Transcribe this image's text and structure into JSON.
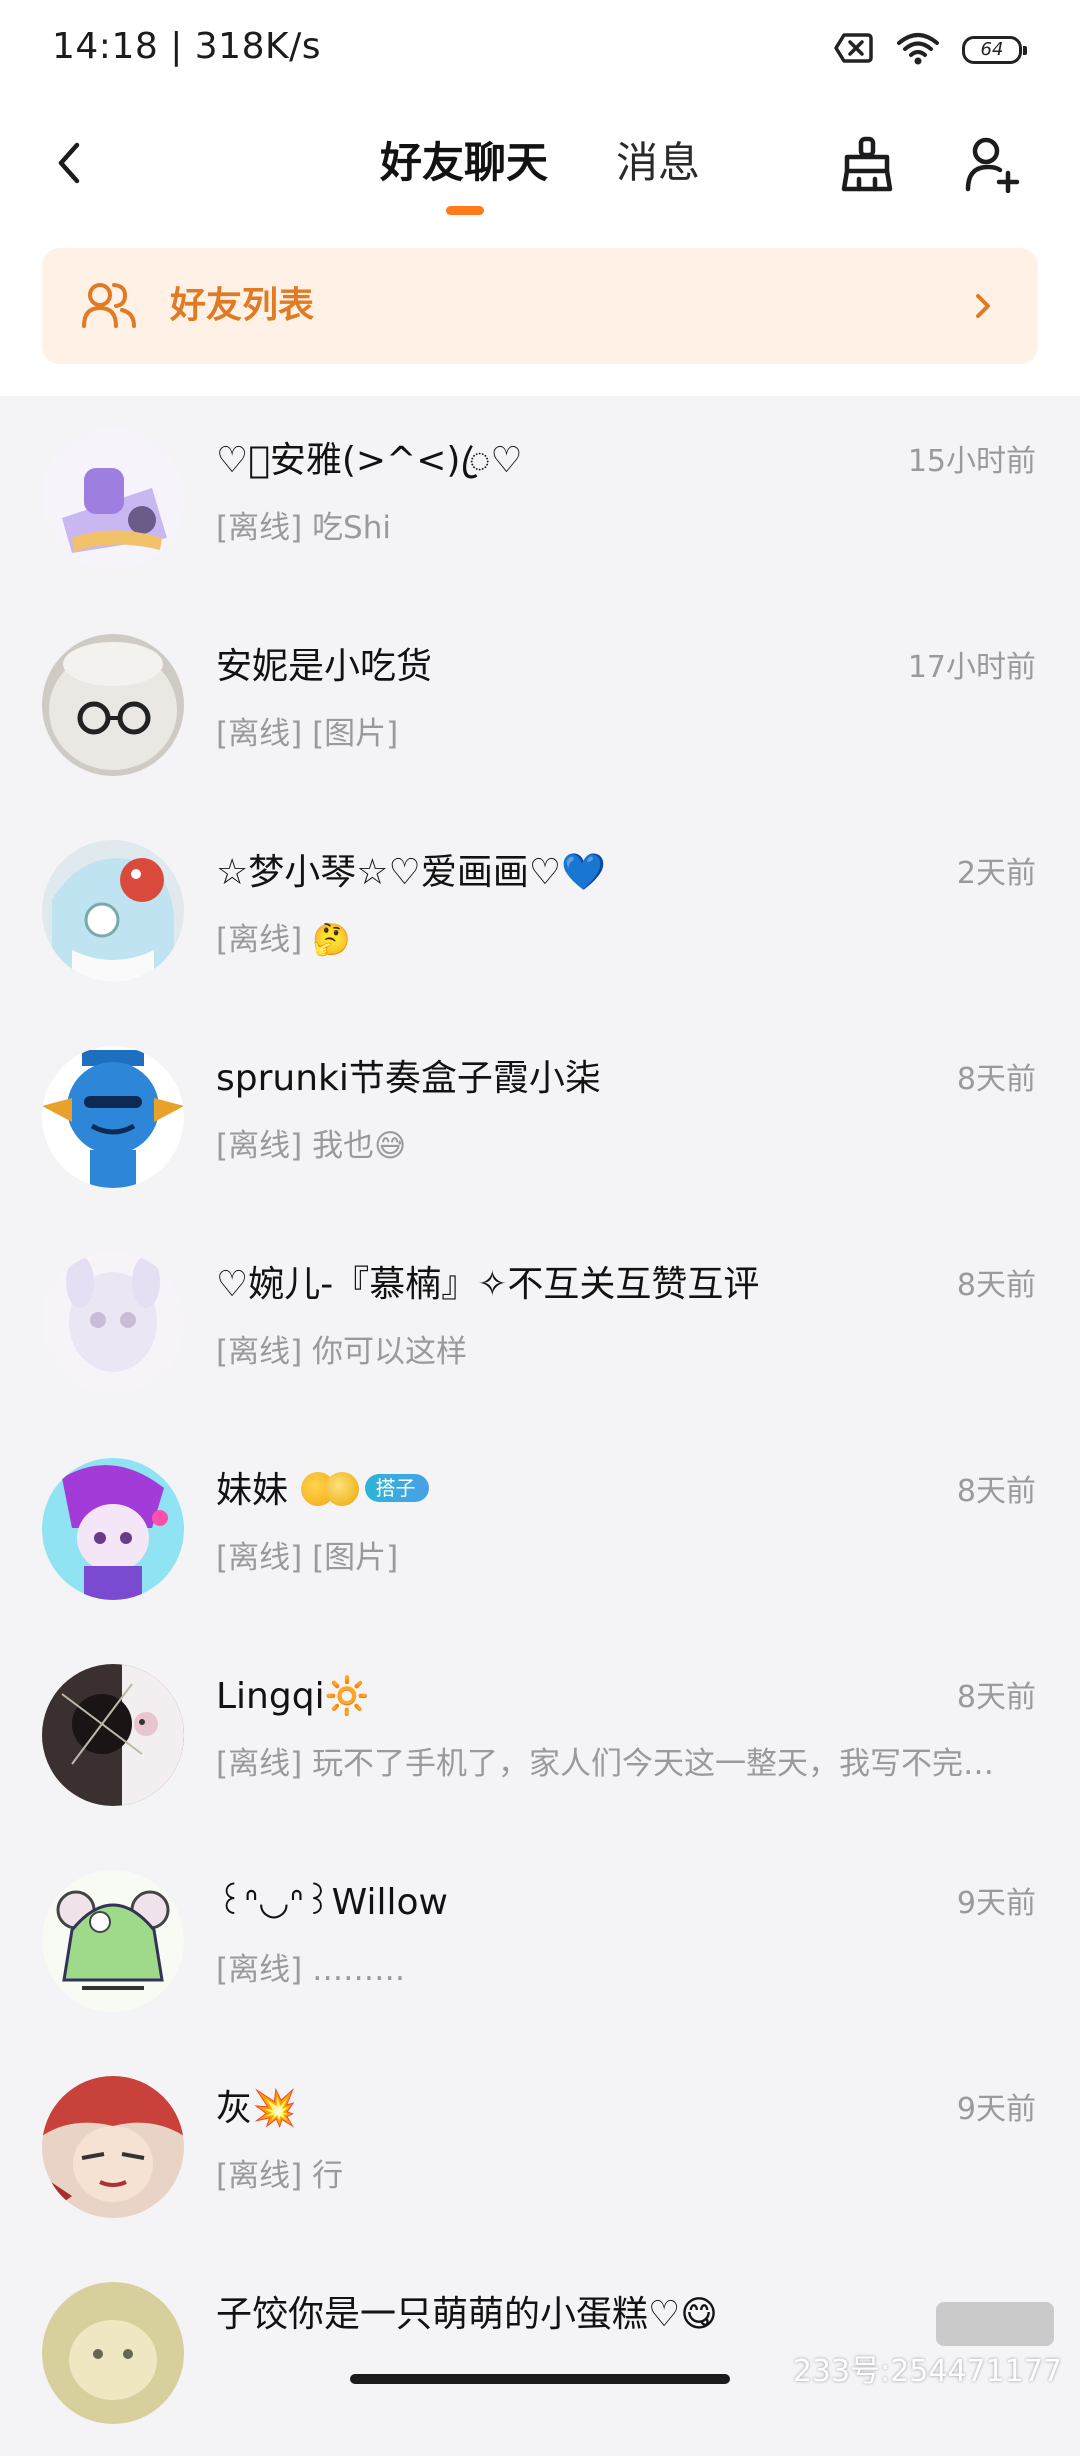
{
  "status_bar": {
    "time_speed": "14:18 | 318K/s",
    "battery": "64"
  },
  "header": {
    "tabs": [
      {
        "label": "好友聊天",
        "active": true
      },
      {
        "label": "消息",
        "active": false
      }
    ],
    "accent_color": "#ff7a1a"
  },
  "friend_list_entry": {
    "label": "好友列表"
  },
  "chats": [
    {
      "name": "♡ꦿ安雅(>^<)ꦿ♡",
      "status": "[离线]",
      "message": "吃Shi",
      "time": "15小时前",
      "avatar_color": "#c9b7f2"
    },
    {
      "name": "安妮是小吃货",
      "status": "[离线]",
      "message": "[图片]",
      "time": "17小时前",
      "avatar_color": "#dedad5"
    },
    {
      "name": "☆梦小琴☆♡爱画画♡💙",
      "status": "[离线]",
      "message": "🤔",
      "time": "2天前",
      "avatar_color": "#bfe3f0"
    },
    {
      "name": "sprunki节奏盒子霞小柒",
      "status": "[离线]",
      "message": "我也😅",
      "time": "8天前",
      "avatar_color": "#2d86d8"
    },
    {
      "name": "♡婉儿-『慕楠』✧不互关互赞互评",
      "status": "[离线]",
      "message": "你可以这样",
      "time": "8天前",
      "avatar_color": "#ece6f4"
    },
    {
      "name": "妹妹",
      "status": "[离线]",
      "message": "[图片]",
      "time": "8天前",
      "tag": "搭子",
      "avatar_color": "#8fe3f2"
    },
    {
      "name": "Lingqi🔆",
      "status": "[离线]",
      "message": "玩不了手机了，家人们今天这一整天，我写不完…",
      "time": "8天前",
      "avatar_color": "#3a3030"
    },
    {
      "name": "꒰ᐢ◡ᐢ꒱Willow",
      "status": "[离线]",
      "message": "………",
      "time": "9天前",
      "avatar_color": "#9fd98a"
    },
    {
      "name": "灰💥",
      "status": "[离线]",
      "message": "行",
      "time": "9天前",
      "avatar_color": "#c8413a"
    },
    {
      "name": "子饺你是一只萌萌的小蛋糕♡😋",
      "status": "",
      "message": "",
      "time": "",
      "avatar_color": "#d8d09c"
    }
  ],
  "watermark": {
    "text": "233号:254471177"
  }
}
